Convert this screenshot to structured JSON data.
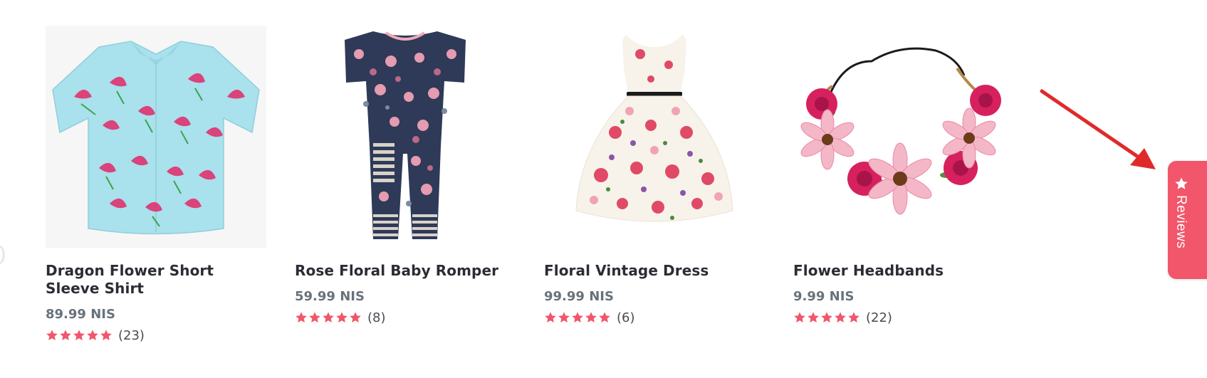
{
  "products": [
    {
      "title": "Dragon Flower Short Sleeve Shirt",
      "price": "89.99 NIS",
      "rating": 5,
      "reviews": "(23)"
    },
    {
      "title": "Rose Floral Baby Romper",
      "price": "59.99 NIS",
      "rating": 5,
      "reviews": "(8)"
    },
    {
      "title": "Floral Vintage Dress",
      "price": "99.99 NIS",
      "rating": 5,
      "reviews": "(6)"
    },
    {
      "title": "Flower Headbands",
      "price": "9.99 NIS",
      "rating": 5,
      "reviews": "(22)"
    }
  ],
  "reviews_tab": {
    "label": "Reviews",
    "icon": "star-icon"
  },
  "colors": {
    "accent": "#f1566a",
    "star": "#f1566a",
    "title": "#2c2c34",
    "price": "#69727b",
    "arrow": "#e02a2a"
  }
}
